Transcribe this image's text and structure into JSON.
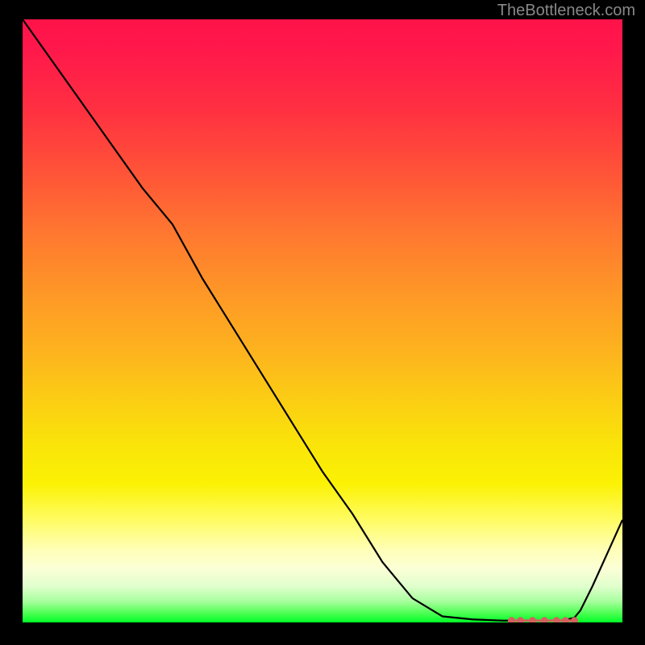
{
  "watermark": "TheBottleneck.com",
  "chart_data": {
    "type": "line",
    "title": "",
    "xlabel": "",
    "ylabel": "",
    "x": [
      0.0,
      0.05,
      0.1,
      0.15,
      0.2,
      0.25,
      0.3,
      0.35,
      0.4,
      0.45,
      0.5,
      0.55,
      0.6,
      0.65,
      0.7,
      0.75,
      0.8,
      0.815,
      0.85,
      0.88,
      0.9,
      0.92,
      0.93,
      0.95,
      1.0
    ],
    "values": [
      1.0,
      0.93,
      0.86,
      0.79,
      0.72,
      0.66,
      0.57,
      0.49,
      0.41,
      0.33,
      0.25,
      0.18,
      0.1,
      0.04,
      0.01,
      0.005,
      0.003,
      0.003,
      0.003,
      0.003,
      0.003,
      0.008,
      0.02,
      0.06,
      0.17
    ],
    "flat_region_x": [
      0.815,
      0.92
    ],
    "markers": [
      {
        "x": 0.815,
        "y": 0.003,
        "color": "#d4605f"
      },
      {
        "x": 0.83,
        "y": 0.003,
        "color": "#d4605f"
      },
      {
        "x": 0.85,
        "y": 0.003,
        "color": "#d4605f"
      },
      {
        "x": 0.87,
        "y": 0.003,
        "color": "#d4605f"
      },
      {
        "x": 0.89,
        "y": 0.003,
        "color": "#d4605f"
      },
      {
        "x": 0.905,
        "y": 0.003,
        "color": "#d4605f"
      },
      {
        "x": 0.92,
        "y": 0.003,
        "color": "#d4605f"
      }
    ],
    "gradient_colors": {
      "top": "#ff134a",
      "bottom": "#00ff26"
    },
    "xlim": [
      0,
      1
    ],
    "ylim": [
      0,
      1
    ]
  }
}
